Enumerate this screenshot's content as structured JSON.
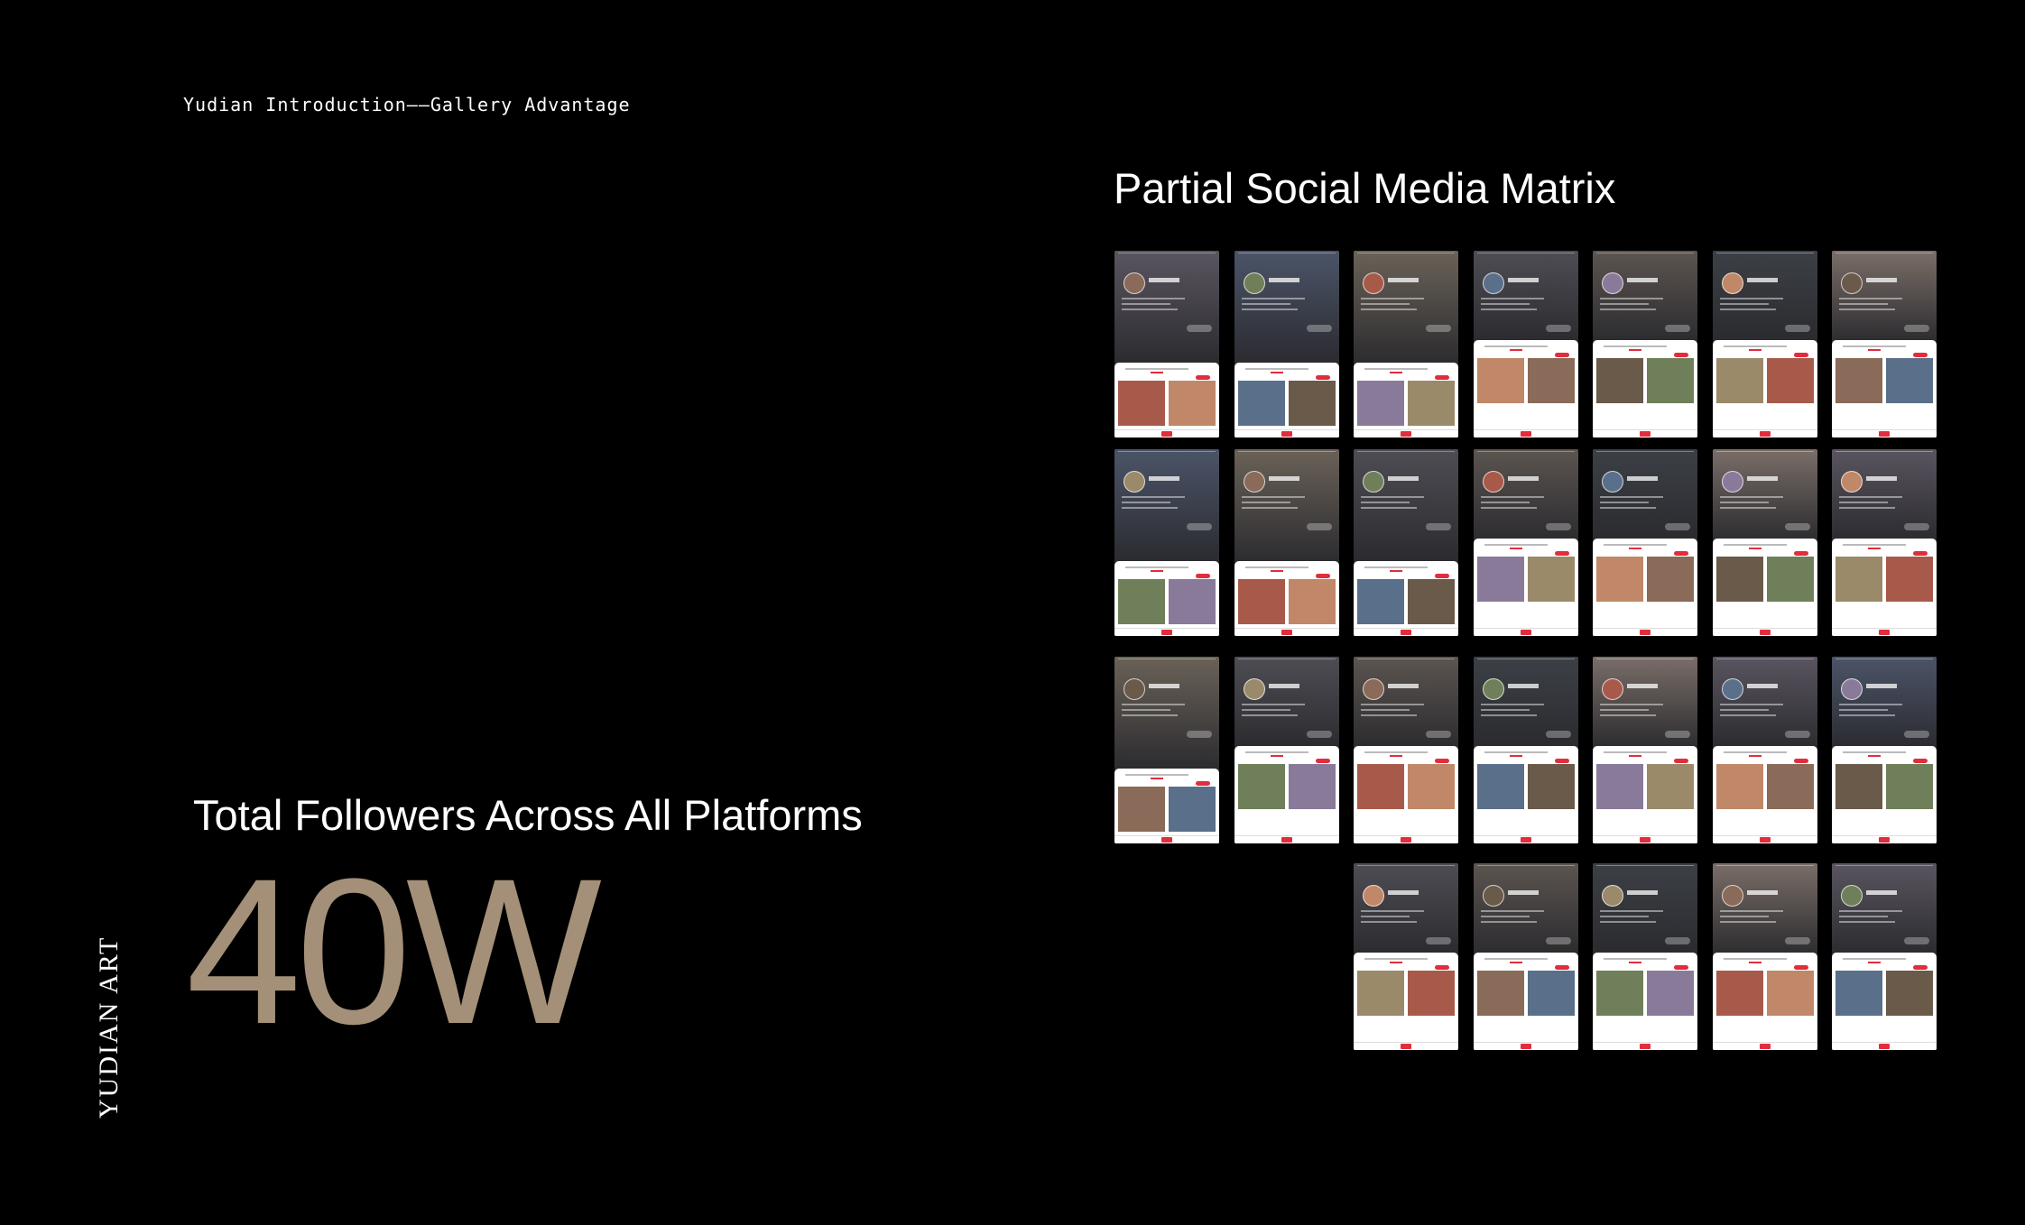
{
  "header": {
    "breadcrumb": "Yudian Introduction——Gallery Advantage"
  },
  "brand": {
    "vertical_label": "YUDIAN ART"
  },
  "followers": {
    "title": "Total Followers Across All Platforms",
    "value": "40W",
    "value_color": "#a49078"
  },
  "matrix": {
    "title": "Partial Social Media Matrix",
    "accent_color": "#e22d3c",
    "rows": [
      {
        "count": 7,
        "offset": 0
      },
      {
        "count": 7,
        "offset": 0
      },
      {
        "count": 7,
        "offset": 0
      },
      {
        "count": 5,
        "offset": 2
      }
    ],
    "palette": [
      "#5a5560",
      "#4b5468",
      "#6a6258",
      "#4e4d54",
      "#5c5550",
      "#3c4046",
      "#7a6e68"
    ]
  }
}
